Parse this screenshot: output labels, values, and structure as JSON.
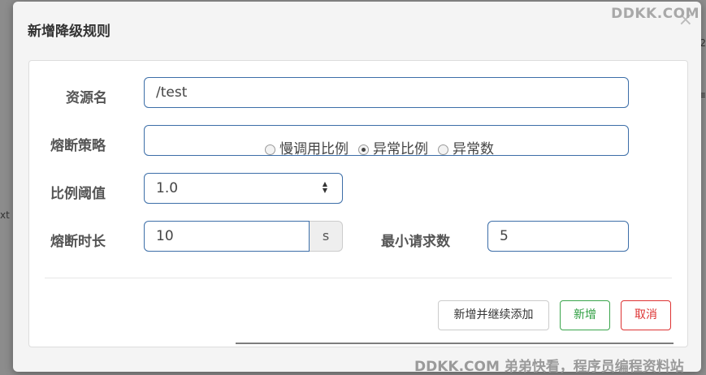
{
  "modal": {
    "title": "新增降级规则",
    "close": "×"
  },
  "watermark": {
    "top": "DDKK.COM",
    "bottom": "DDKK.COM 弟弟快看，程序员编程资料站"
  },
  "background": {
    "side_text": "xt",
    "right_text_1": "2",
    "right_text_2": "≡"
  },
  "form": {
    "resource_label": "资源名",
    "resource_value": "/test",
    "strategy_label": "熔断策略",
    "strategy_options": [
      "慢调用比例",
      "异常比例",
      "异常数"
    ],
    "strategy_selected": "异常比例",
    "ratio_label": "比例阈值",
    "ratio_value": "1.0",
    "duration_label": "熔断时长",
    "duration_value": "10",
    "duration_unit": "s",
    "min_request_label": "最小请求数",
    "min_request_value": "5"
  },
  "buttons": {
    "add_continue": "新增并继续添加",
    "add": "新增",
    "cancel": "取消"
  },
  "colors": {
    "input_border": "#3c6ea8",
    "add_green": "#2e9e41",
    "cancel_red": "#dd3333"
  }
}
